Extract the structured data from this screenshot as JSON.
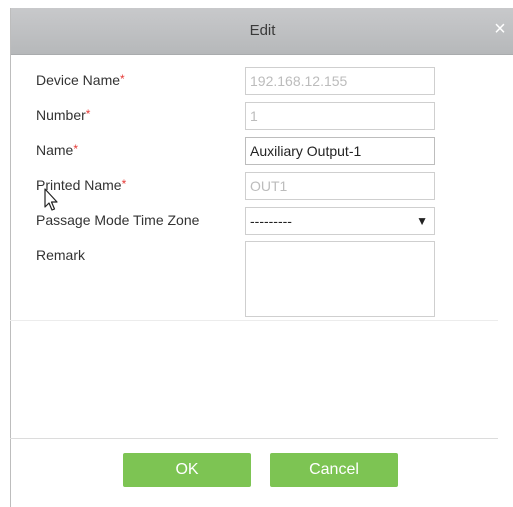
{
  "dialog": {
    "title": "Edit",
    "close_symbol": "×"
  },
  "form": {
    "required_mark": "*",
    "device_name": {
      "label": "Device Name",
      "value": "192.168.12.155",
      "required": true,
      "disabled": true
    },
    "number": {
      "label": "Number",
      "value": "1",
      "required": true,
      "disabled": true
    },
    "name": {
      "label": "Name",
      "value": "Auxiliary Output-1",
      "required": true,
      "disabled": false
    },
    "printed_name": {
      "label": "Printed Name",
      "value": "OUT1",
      "required": true,
      "disabled": true
    },
    "passage_mode": {
      "label": "Passage Mode Time Zone",
      "selected": "---------",
      "caret": "▼"
    },
    "remark": {
      "label": "Remark",
      "value": ""
    }
  },
  "buttons": {
    "ok": "OK",
    "cancel": "Cancel"
  },
  "colors": {
    "accent_button": "#7dc453",
    "required": "#e53935",
    "titlebar": "#c0c1c3"
  },
  "icons": [
    "close-icon",
    "dropdown-caret-icon",
    "mouse-cursor-icon"
  ]
}
